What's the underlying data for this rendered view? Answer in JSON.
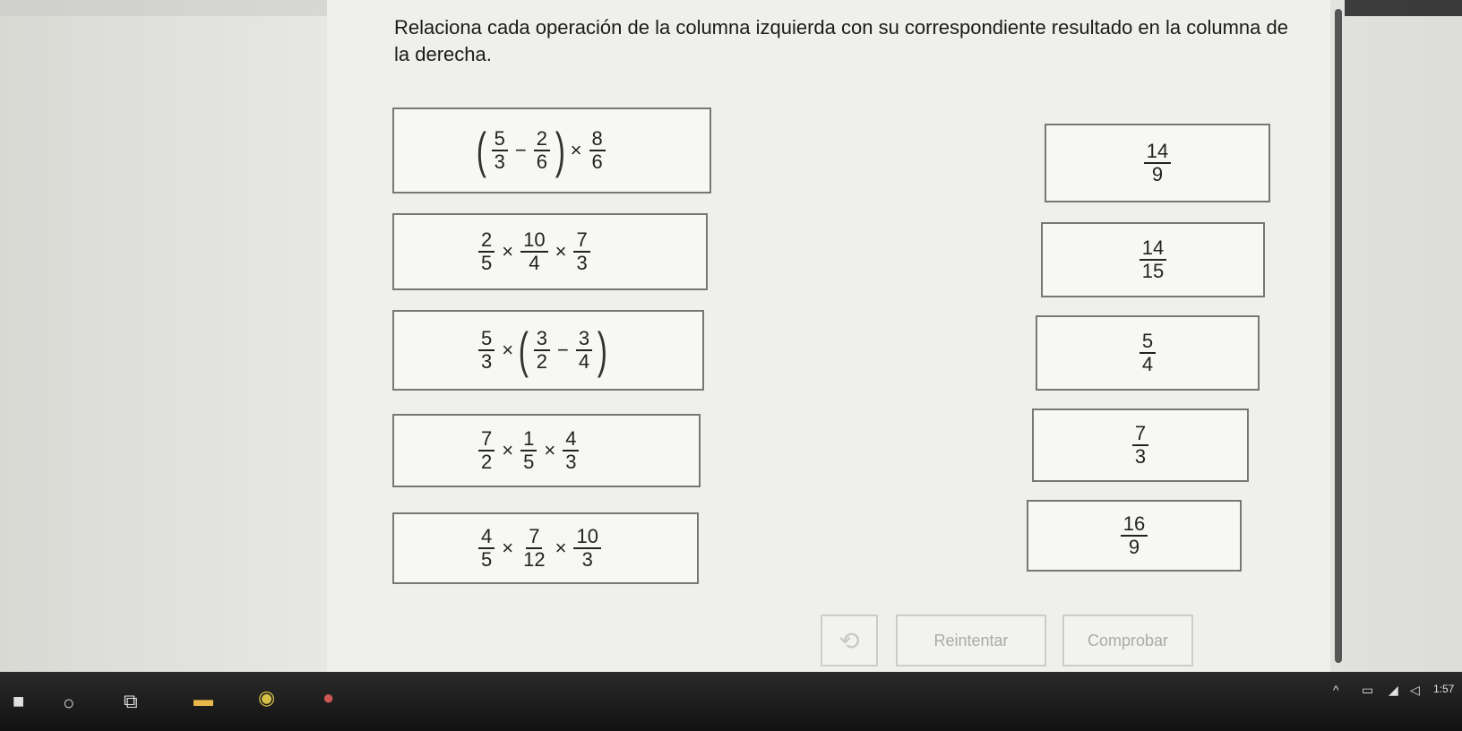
{
  "instructions": "Relaciona cada operación de la columna izquierda con su correspondiente resultado en la columna de la derecha.",
  "left_items": [
    {
      "type": "paren-first",
      "a": [
        "5",
        "3"
      ],
      "op1": "−",
      "b": [
        "2",
        "6"
      ],
      "op2": "×",
      "c": [
        "8",
        "6"
      ]
    },
    {
      "type": "triple",
      "a": [
        "2",
        "5"
      ],
      "op1": "×",
      "b": [
        "10",
        "4"
      ],
      "op2": "×",
      "c": [
        "7",
        "3"
      ]
    },
    {
      "type": "paren-last",
      "a": [
        "5",
        "3"
      ],
      "op1": "×",
      "b": [
        "3",
        "2"
      ],
      "op2": "−",
      "c": [
        "3",
        "4"
      ]
    },
    {
      "type": "triple",
      "a": [
        "7",
        "2"
      ],
      "op1": "×",
      "b": [
        "1",
        "5"
      ],
      "op2": "×",
      "c": [
        "4",
        "3"
      ]
    },
    {
      "type": "triple",
      "a": [
        "4",
        "5"
      ],
      "op1": "×",
      "b": [
        "7",
        "12"
      ],
      "op2": "×",
      "c": [
        "10",
        "3"
      ]
    }
  ],
  "right_items": [
    {
      "num": "14",
      "den": "9"
    },
    {
      "num": "14",
      "den": "15"
    },
    {
      "num": "5",
      "den": "4"
    },
    {
      "num": "7",
      "den": "3"
    },
    {
      "num": "16",
      "den": "9"
    }
  ],
  "buttons": {
    "undo_icon": "undo-icon",
    "retry_label": "Reintentar",
    "check_label": "Comprobar"
  },
  "taskbar": {
    "clock": "1:57"
  }
}
